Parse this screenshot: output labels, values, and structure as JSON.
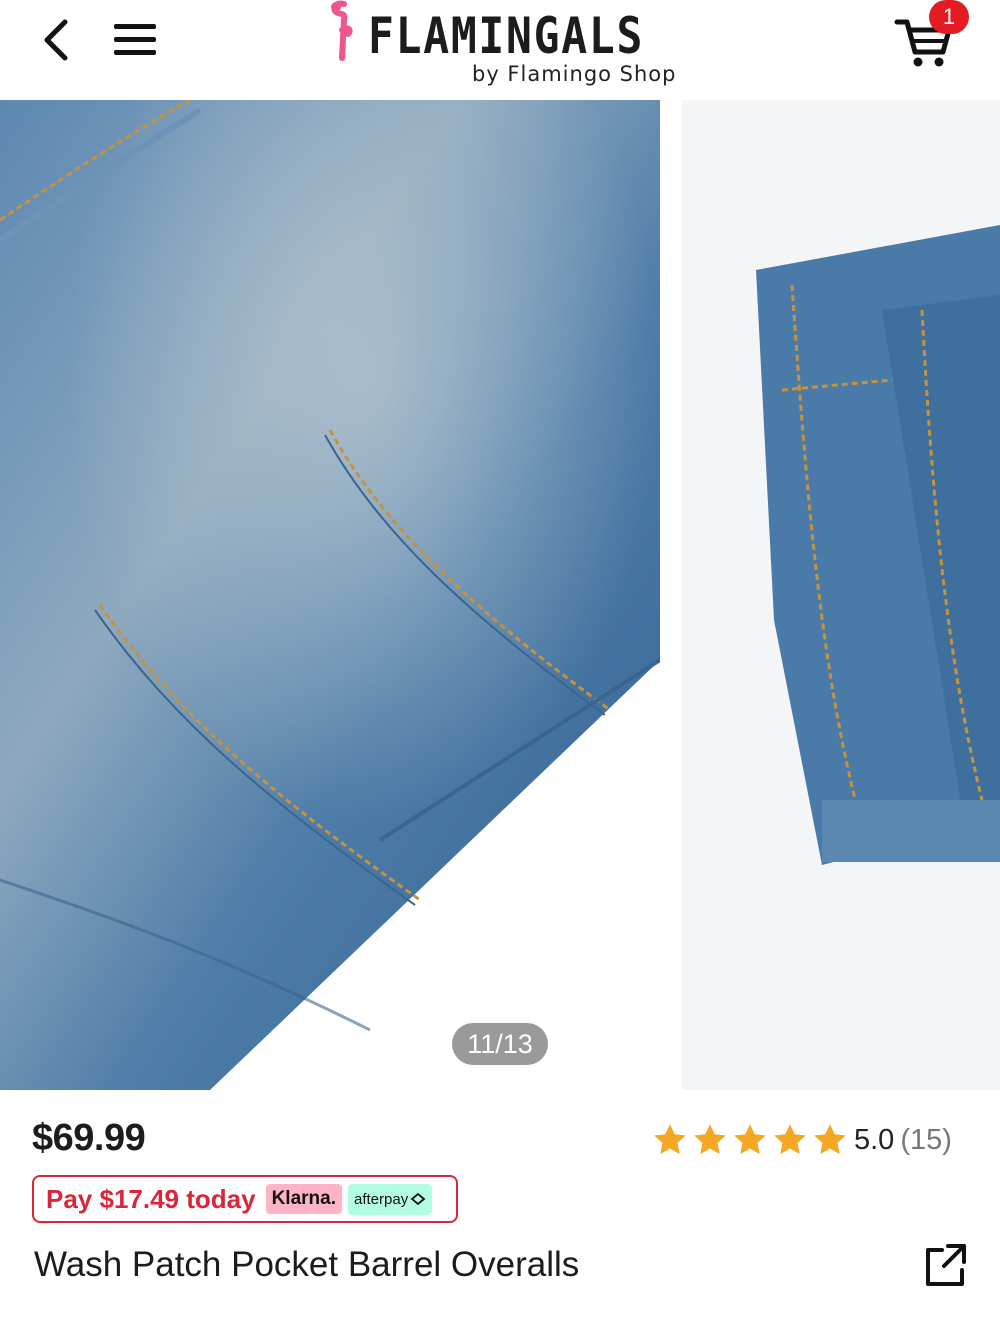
{
  "header": {
    "brand_name": "FLAMINGALS",
    "brand_tagline": "by Flamingo Shop",
    "cart_count": "1",
    "brand_color": "#f0568e"
  },
  "gallery": {
    "counter": "11/13",
    "denim_color": "#4a7ba8",
    "stitch_color": "#c8923a"
  },
  "product": {
    "price": "$69.99",
    "rating_value": 5,
    "rating_score": "5.0",
    "rating_count": "(15)",
    "star_color": "#f5a623",
    "pay_today": "Pay $17.49 today",
    "klarna_label": "Klarna.",
    "afterpay_label": "afterpay",
    "title": "Wash Patch Pocket Barrel Overalls"
  },
  "icons": {
    "back": "chevron-left-icon",
    "menu": "hamburger-menu-icon",
    "cart": "shopping-cart-icon",
    "share": "share-external-icon",
    "star": "star-icon"
  }
}
